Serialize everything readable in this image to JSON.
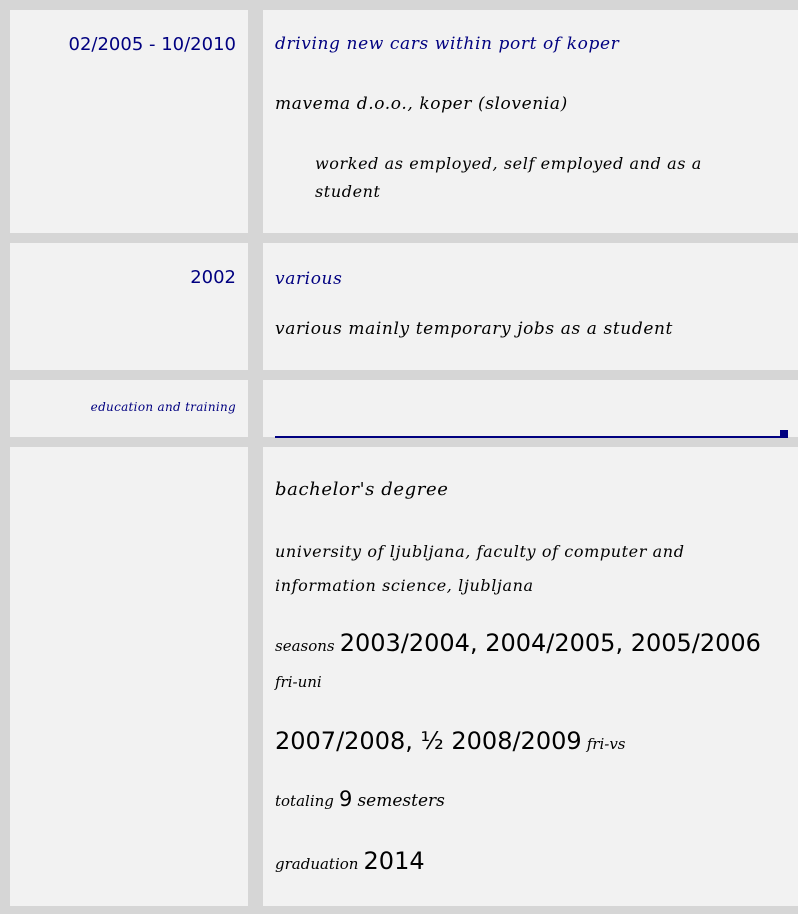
{
  "work": [
    {
      "date": "02/2005 - 10/2010",
      "title": "driving new cars within port of koper",
      "employer": "mavema d.o.o., koper (slovenia)",
      "description": "worked as employed, self employed and as a student"
    },
    {
      "date": "2002",
      "title": "various",
      "employer": "various mainly temporary jobs as a student"
    }
  ],
  "education": {
    "section_label": "education and training",
    "degree": "bachelor's degree",
    "institution": "university of ljubljana, faculty of computer and information science, ljubljana",
    "seasons_prefix": "seasons",
    "seasons_years": "2003/2004, 2004/2005, 2005/2006",
    "seasons_program_1": "fri-uni",
    "seasons_years_2": "2007/2008, ½ 2008/2009",
    "seasons_program_2": "fri-vs",
    "totaling_prefix": "totaling",
    "totaling_number": "9",
    "totaling_suffix": "semesters",
    "graduation_prefix": "graduation",
    "graduation_year": "2014"
  }
}
